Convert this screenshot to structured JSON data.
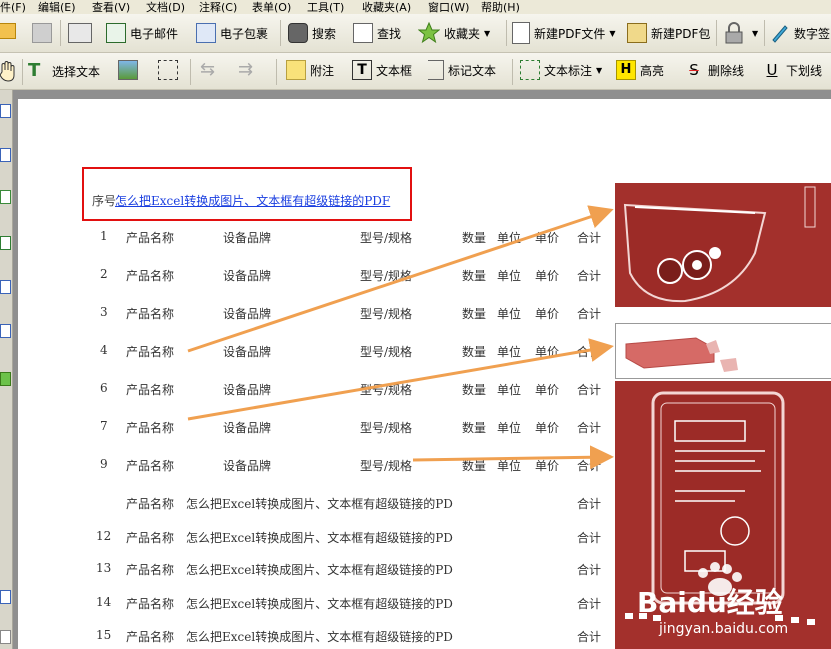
{
  "menu": [
    "件(F)",
    "编辑(E)",
    "查看(V)",
    "文档(D)",
    "注释(C)",
    "表单(O)",
    "工具(T)",
    "收藏夹(A)",
    "窗口(W)",
    "帮助(H)"
  ],
  "toolbar1": {
    "email": "电子邮件",
    "pdf_package": "电子包裹",
    "search": "搜索",
    "find": "查找",
    "favorites": "收藏夹",
    "new_pdf": "新建PDF文件",
    "new_pdf_package": "新建PDF包",
    "digital_sign": "数字签"
  },
  "toolbar2": {
    "select_text": "选择文本",
    "note": "附注",
    "textbox": "文本框",
    "mark_text": "标记文本",
    "text_callout": "文本标注",
    "highlight": "高亮",
    "strikethrough": "删除线",
    "underline": "下划线"
  },
  "document": {
    "header_seq": "序号",
    "header_link": "怎么把Excel转换成图片、文本框有超级链接的PDF",
    "rows": [
      {
        "no": "1",
        "name": "产品名称",
        "brand": "设备品牌",
        "model": "型号/规格",
        "qty": "数量",
        "unit": "单位",
        "price": "单价",
        "total": "合计"
      },
      {
        "no": "2",
        "name": "产品名称",
        "brand": "设备品牌",
        "model": "型号/规格",
        "qty": "数量",
        "unit": "单位",
        "price": "单价",
        "total": "合计"
      },
      {
        "no": "3",
        "name": "产品名称",
        "brand": "设备品牌",
        "model": "型号/规格",
        "qty": "数量",
        "unit": "单位",
        "price": "单价",
        "total": "合计"
      },
      {
        "no": "4",
        "name": "产品名称",
        "brand": "设备品牌",
        "model": "型号/规格",
        "qty": "数量",
        "unit": "单位",
        "price": "单价",
        "total": "合计"
      },
      {
        "no": "6",
        "name": "产品名称",
        "brand": "设备品牌",
        "model": "型号/规格",
        "qty": "数量",
        "unit": "单位",
        "price": "单价",
        "total": "合计"
      },
      {
        "no": "7",
        "name": "产品名称",
        "brand": "设备品牌",
        "model": "型号/规格",
        "qty": "数量",
        "unit": "单位",
        "price": "单价",
        "total": "合计"
      },
      {
        "no": "9",
        "name": "产品名称",
        "brand": "设备品牌",
        "model": "型号/规格",
        "qty": "数量",
        "unit": "单位",
        "price": "单价",
        "total": "合计"
      }
    ],
    "link_rows": [
      {
        "no": "",
        "name": "产品名称",
        "text": "怎么把Excel转换成图片、文本框有超级链接的PD",
        "total": "合计"
      },
      {
        "no": "12",
        "name": "产品名称",
        "text": "怎么把Excel转换成图片、文本框有超级链接的PD",
        "total": "合计"
      },
      {
        "no": "13",
        "name": "产品名称",
        "text": "怎么把Excel转换成图片、文本框有超级链接的PD",
        "total": "合计"
      },
      {
        "no": "14",
        "name": "产品名称",
        "text": "怎么把Excel转换成图片、文本框有超级链接的PD",
        "total": "合计"
      },
      {
        "no": "15",
        "name": "产品名称",
        "text": "怎么把Excel转换成图片、文本框有超级链接的PD",
        "total": "合计"
      }
    ]
  },
  "watermark": {
    "brand": "Baidu经验",
    "url": "jingyan.baidu.com"
  },
  "colors": {
    "highlight_box": "#e21010",
    "arrow": "#f0a050",
    "photo_bg": "#a3302c",
    "link": "#1a3ee0"
  }
}
